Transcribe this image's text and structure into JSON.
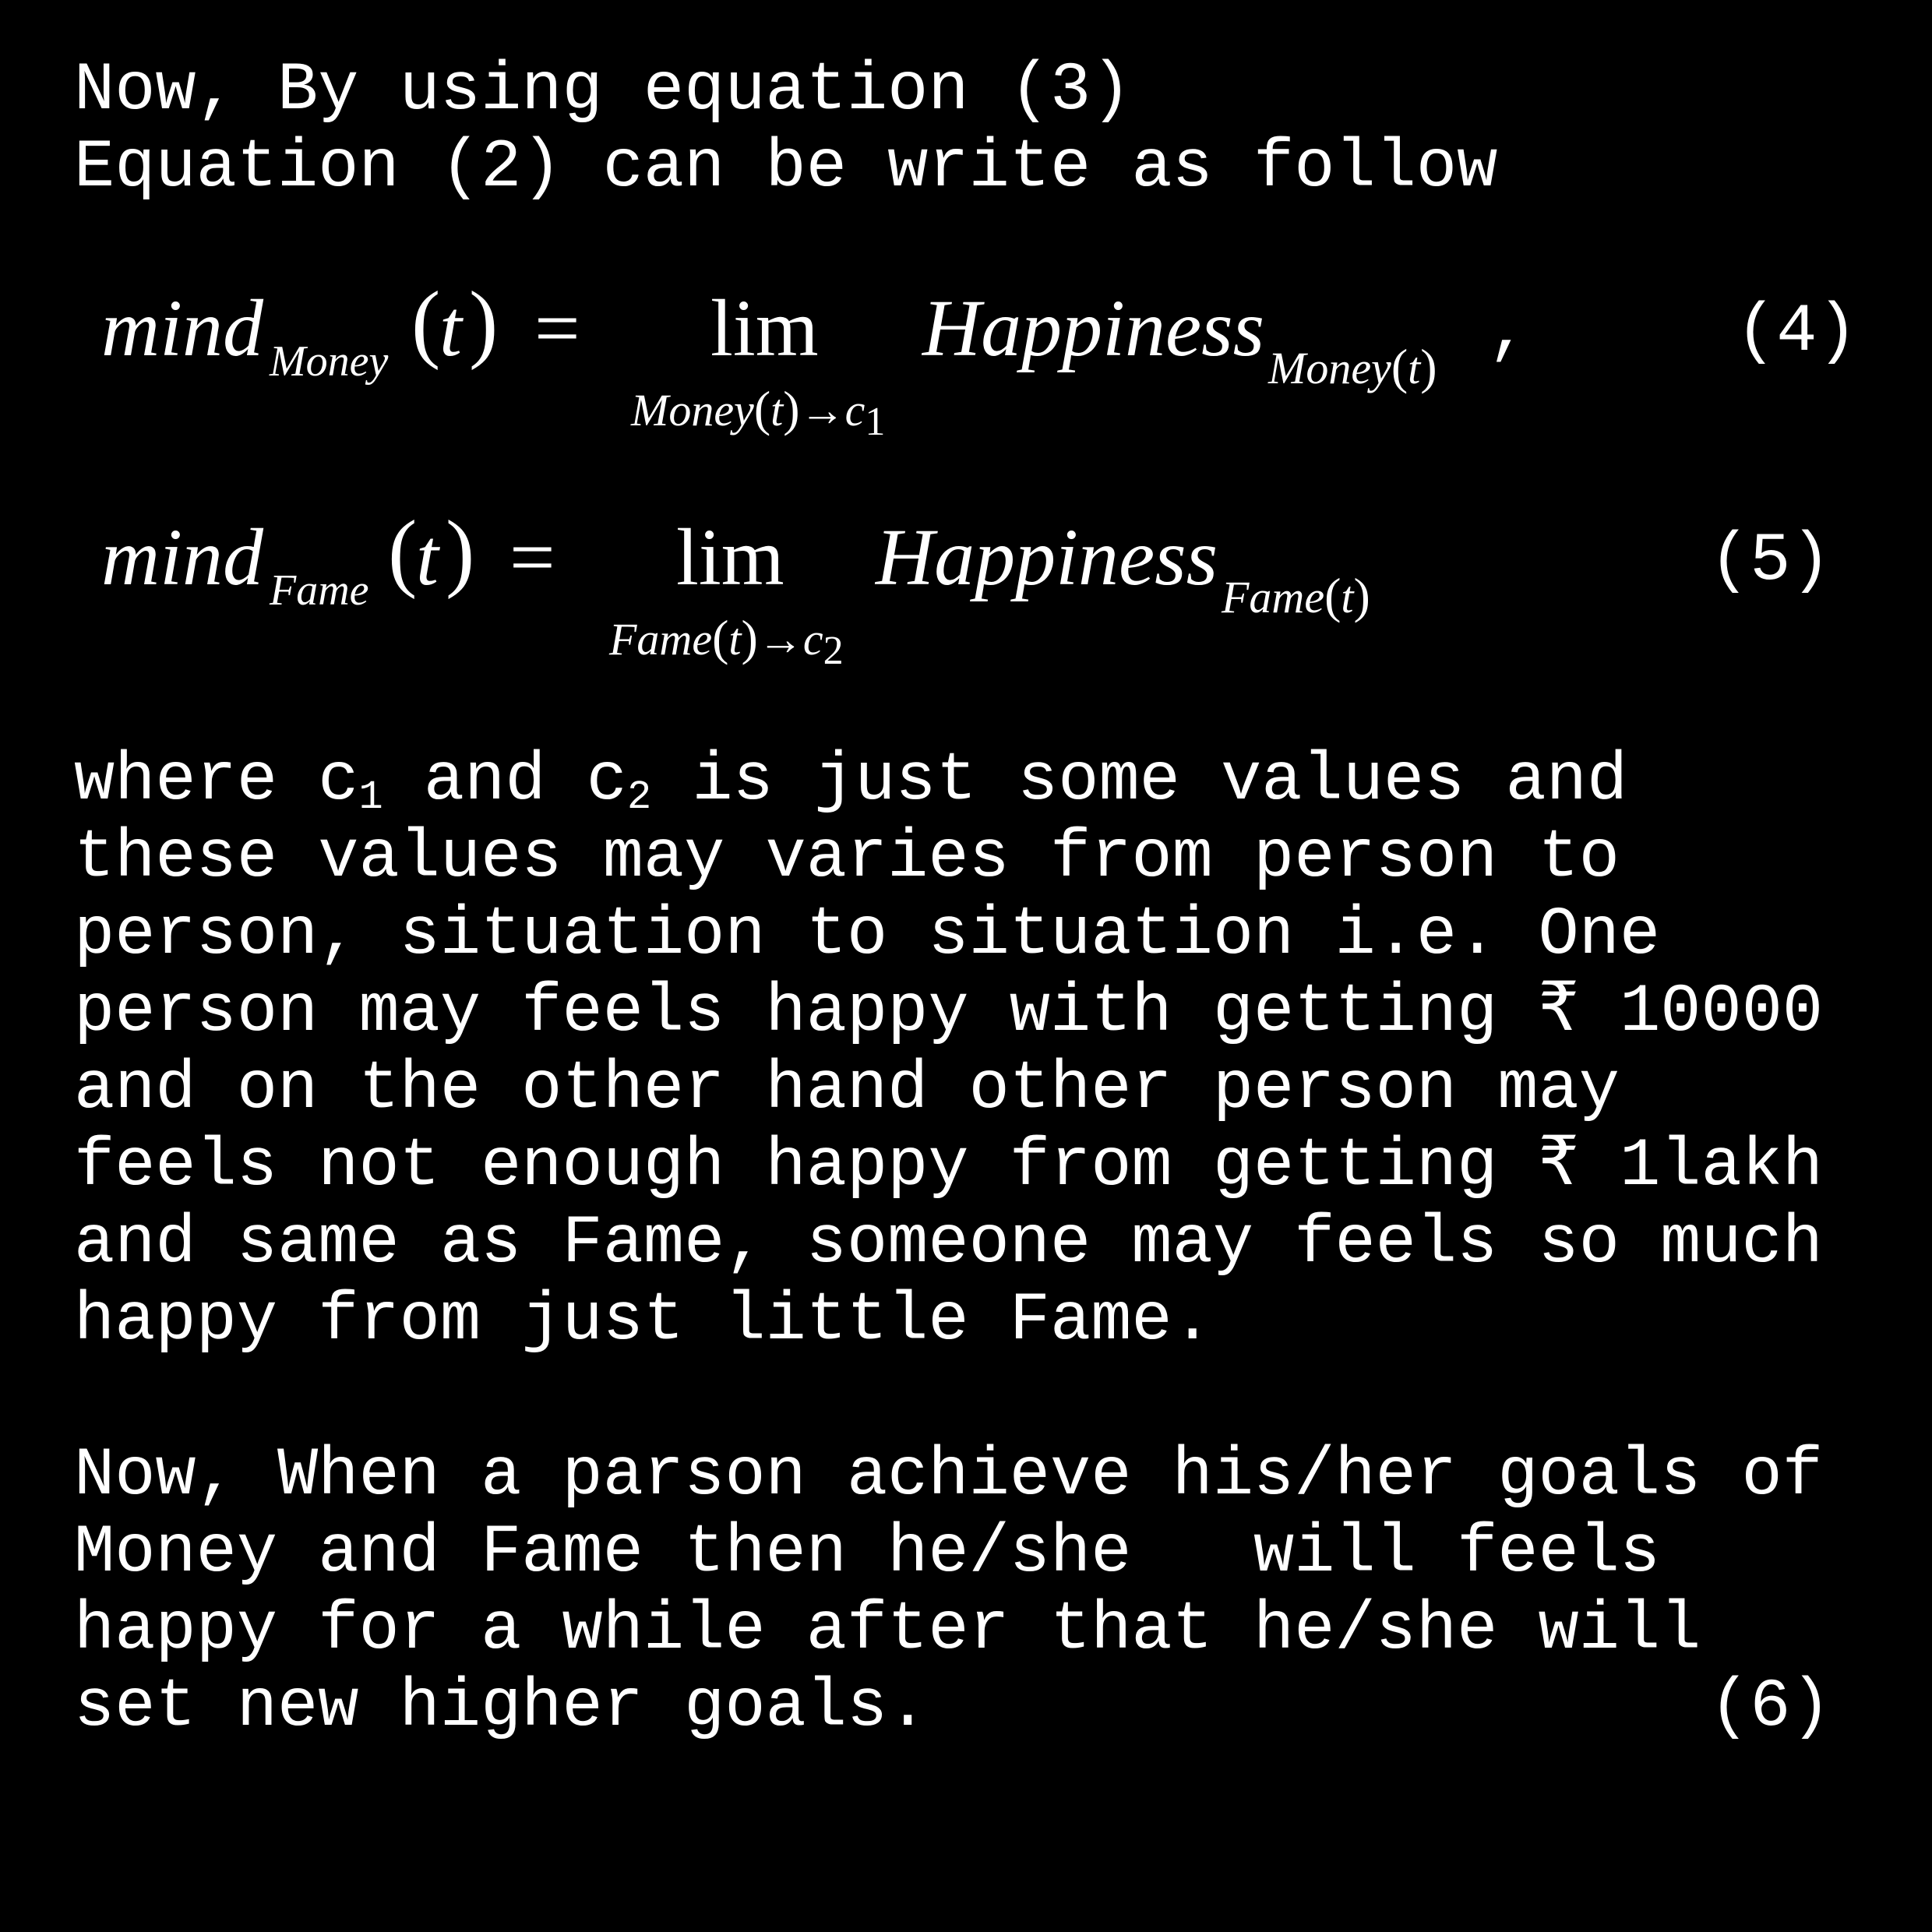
{
  "intro": {
    "line1": "Now, By using equation (3)",
    "line2": "Equation (2) can be write as follow"
  },
  "eq4": {
    "lhs_fn": "mind",
    "lhs_sub": "Money",
    "lhs_arg_open": "(",
    "lhs_arg": "t",
    "lhs_arg_close": ")",
    "equals": "=",
    "lim": "lim",
    "lim_under_var": "Money",
    "lim_under_arg": "t",
    "lim_arrow": "→",
    "lim_under_target": "c",
    "lim_under_target_sub": "1",
    "rhs_fn": "Happiness",
    "rhs_sub_var": "Money",
    "rhs_sub_arg": "t",
    "comma": ",",
    "number": "(4)"
  },
  "eq5": {
    "lhs_fn": "mind",
    "lhs_sub": "Fame",
    "lhs_arg_open": "(",
    "lhs_arg": "t",
    "lhs_arg_close": ")",
    "equals": "=",
    "lim": "lim",
    "lim_under_var": "Fame",
    "lim_under_arg": "t",
    "lim_arrow": "→",
    "lim_under_target": "c",
    "lim_under_target_sub": "2",
    "rhs_fn": "Happiness",
    "rhs_sub_var": "Fame",
    "rhs_sub_arg": "t",
    "number": "(5)"
  },
  "para1": {
    "line1_a": "where c",
    "line1_sub1": "1",
    "line1_b": " and c",
    "line1_sub2": "2",
    "line1_c": " is just some values and",
    "line2": "these values may varies from person to",
    "line3": "person, situation to situation i.e. One",
    "line4": "person may feels happy with getting ₹ 10000",
    "line5": "and on the other hand other person may",
    "line6": "feels not enough happy from getting ₹ 1lakh",
    "line7": "and same as Fame, someone may feels so much",
    "line8": "happy from just little Fame."
  },
  "para2": {
    "line1": "Now, When a parson achieve his/her goals of",
    "line2": "Money and Fame then he/she   will feels",
    "line3": "happy for a while after that he/she will",
    "line4": "set new higher goals.",
    "number": "(6)"
  }
}
